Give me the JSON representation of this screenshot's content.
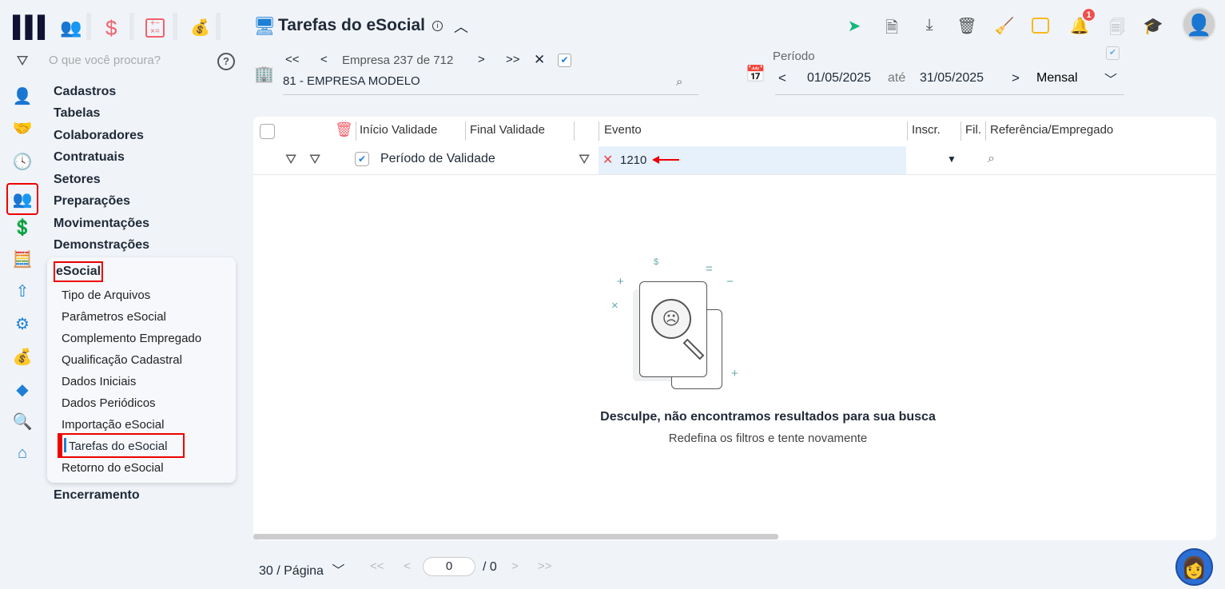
{
  "topbar": {
    "modules": [
      "people-icon",
      "dollar-icon",
      "calculator-icon",
      "money-bag-icon"
    ],
    "search_placeholder": "O que você procura?"
  },
  "menu": {
    "items": [
      "Cadastros",
      "Tabelas",
      "Colaboradores",
      "Contratuais",
      "Setores",
      "Preparações",
      "Movimentações",
      "Demonstrações"
    ],
    "esocial": {
      "label": "eSocial",
      "items": [
        "Tipo de Arquivos",
        "Parâmetros eSocial",
        "Complemento Empregado",
        "Qualificação Cadastral",
        "Dados Iniciais",
        "Dados Periódicos",
        "Importação eSocial",
        "Tarefas do eSocial",
        "Retorno do eSocial"
      ],
      "active": "Tarefas do eSocial"
    },
    "last": "Encerramento"
  },
  "page": {
    "title": "Tarefas do eSocial"
  },
  "company": {
    "nav_label": "Empresa",
    "current": "237",
    "of": "de",
    "total": "712",
    "name": "81 - EMPRESA MODELO"
  },
  "period": {
    "label": "Período",
    "start": "01/05/2025",
    "until": "até",
    "end": "31/05/2025",
    "type": "Mensal"
  },
  "notifications": {
    "count": "1"
  },
  "table": {
    "columns": [
      "Início Validade",
      "Final Validade",
      "Evento",
      "Inscr.",
      "Fil.",
      "Referência/Empregado"
    ],
    "filter_period": "Período de Validade",
    "filter_event": "1210"
  },
  "empty": {
    "title": "Desculpe, não encontramos resultados para sua busca",
    "subtitle": "Redefina os filtros e tente novamente"
  },
  "pagination": {
    "per_page": "30 / Página",
    "page": "0",
    "total": "/ 0"
  },
  "colors": {
    "accent": "#1e7fd6",
    "highlight": "#e6f1fc",
    "alert": "#ef4444"
  }
}
